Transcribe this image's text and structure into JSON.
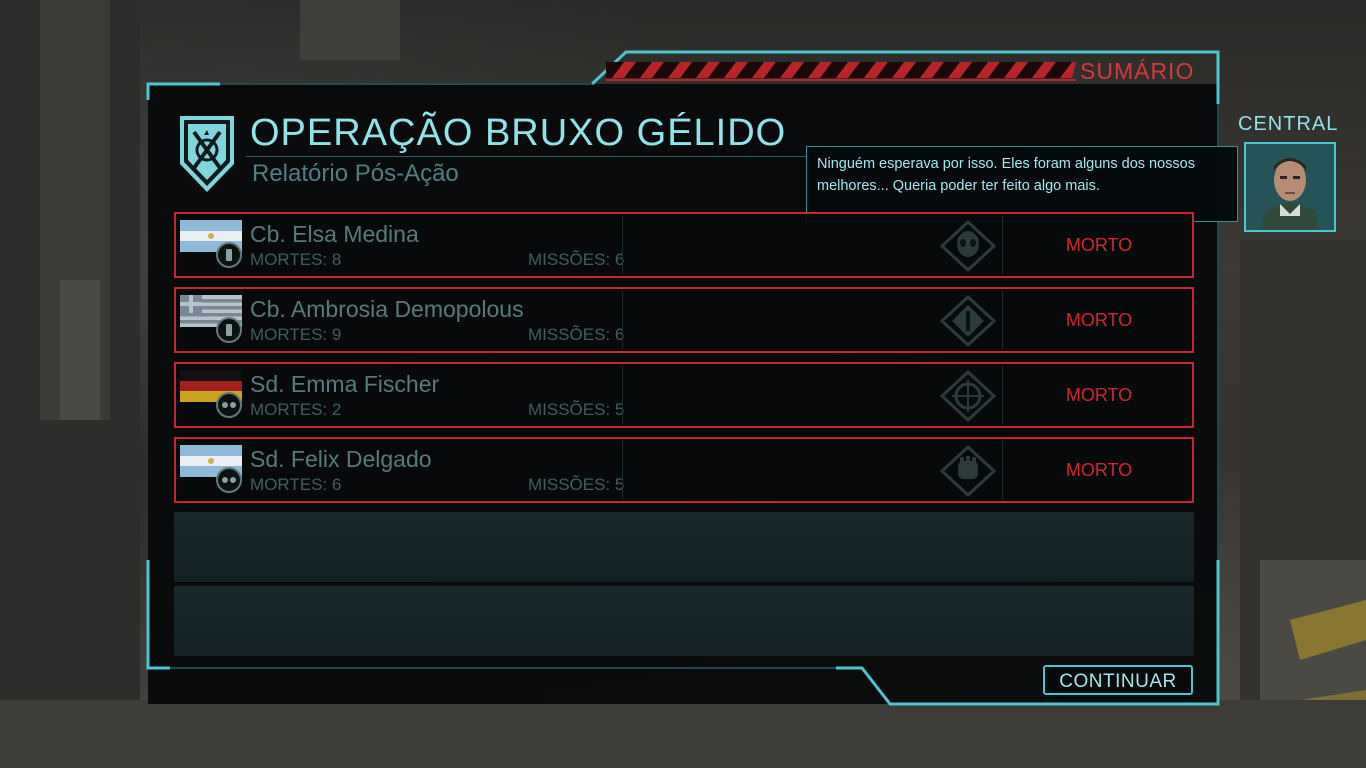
{
  "colors": {
    "accent_cyan": "#49c6cf",
    "title_cyan": "#8fe4ea",
    "dead_red": "#d3262d",
    "row_border": "#c8262d"
  },
  "tab": {
    "label": "SUMÁRIO"
  },
  "header": {
    "logo_icon": "xcom-emblem-icon",
    "title": "OPERAÇÃO BRUXO GÉLIDO",
    "subtitle": "Relatório Pós-Ação"
  },
  "speaker": {
    "name": "CENTRAL",
    "message": "Ninguém esperava por isso. Eles foram alguns dos nossos melhores... Queria poder ter feito algo mais."
  },
  "soldiers": [
    {
      "name": "Cb. Elsa Medina",
      "kills": "MORTES: 8",
      "missions": "MISSÕES: 6",
      "status": "MORTO",
      "flag": "argentina",
      "rank_icon": "corporal-rank-icon",
      "class_icon": "alien-head-icon"
    },
    {
      "name": "Cb. Ambrosia Demopolous",
      "kills": "MORTES: 9",
      "missions": "MISSÕES: 6",
      "status": "MORTO",
      "flag": "greece",
      "rank_icon": "corporal-rank-icon",
      "class_icon": "support-class-icon"
    },
    {
      "name": "Sd. Emma Fischer",
      "kills": "MORTES: 2",
      "missions": "MISSÕES: 5",
      "status": "MORTO",
      "flag": "germany",
      "rank_icon": "private-rank-icon",
      "class_icon": "sniper-class-icon"
    },
    {
      "name": "Sd. Felix Delgado",
      "kills": "MORTES: 6",
      "missions": "MISSÕES: 5",
      "status": "MORTO",
      "flag": "argentina",
      "rank_icon": "private-rank-icon",
      "class_icon": "assault-class-icon"
    }
  ],
  "continue_button": {
    "label": "CONTINUAR"
  }
}
